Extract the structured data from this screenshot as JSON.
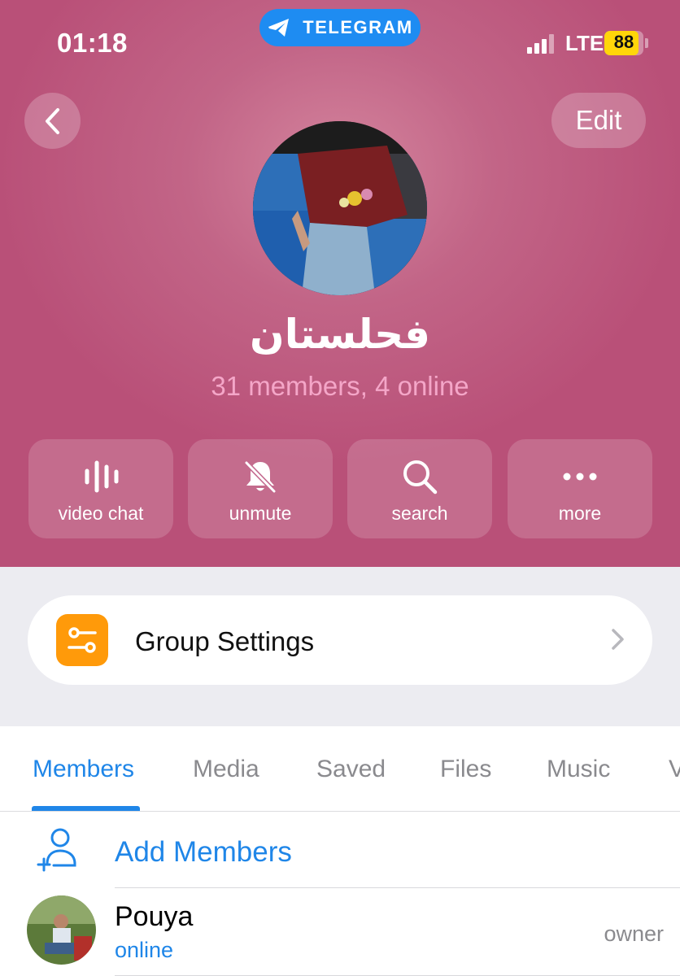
{
  "status_bar": {
    "time": "01:18",
    "app_pill_label": "TELEGRAM",
    "network": "LTE",
    "battery": "88"
  },
  "header": {
    "back_icon": "chevron-left-icon",
    "edit_label": "Edit",
    "group_name": "فحلستان",
    "subtitle": "31 members, 4 online",
    "background_color": "#b95078"
  },
  "actions": [
    {
      "label": "video chat",
      "icon": "voice-bars-icon"
    },
    {
      "label": "unmute",
      "icon": "bell-slash-icon"
    },
    {
      "label": "search",
      "icon": "search-icon"
    },
    {
      "label": "more",
      "icon": "ellipsis-icon"
    }
  ],
  "settings": {
    "label": "Group Settings",
    "icon": "sliders-icon",
    "icon_color": "#ff9a0a"
  },
  "tabs": [
    {
      "label": "Members",
      "active": true
    },
    {
      "label": "Media",
      "active": false
    },
    {
      "label": "Saved",
      "active": false
    },
    {
      "label": "Files",
      "active": false
    },
    {
      "label": "Music",
      "active": false
    },
    {
      "label": "V",
      "active": false
    }
  ],
  "add_members": {
    "label": "Add Members",
    "icon": "add-user-icon"
  },
  "members": [
    {
      "name": "Pouya",
      "status": "online",
      "role": "owner"
    }
  ],
  "accent_color": "#1f86e8"
}
